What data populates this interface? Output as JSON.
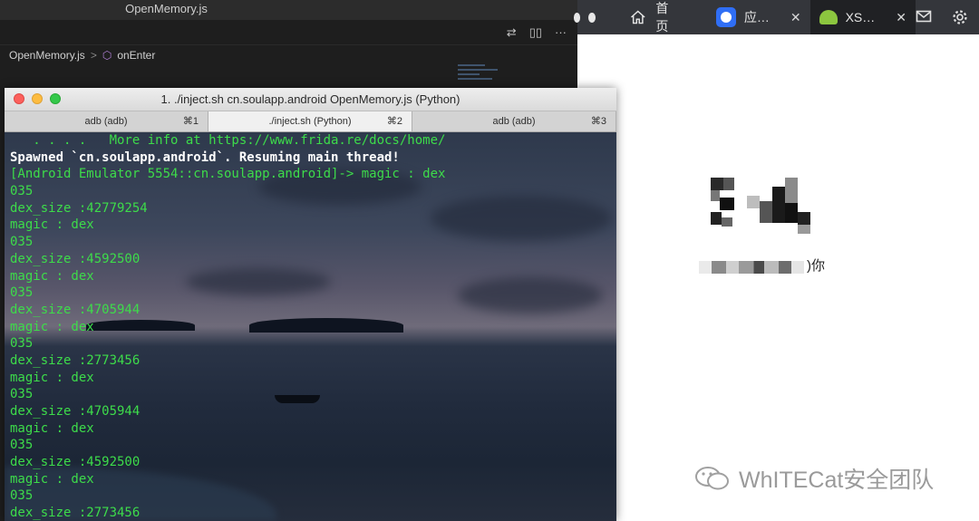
{
  "editor": {
    "window_title": "OpenMemory.js",
    "breadcrumb_file": "OpenMemory.js",
    "breadcrumb_sep": ">",
    "breadcrumb_symbol": "onEnter",
    "action_icons": [
      "source-control-icon",
      "split-editor-icon",
      "more-icon"
    ]
  },
  "browser": {
    "tabs": [
      {
        "label": "首页",
        "icon": "home-icon"
      },
      {
        "label": "应…",
        "icon": "app-icon",
        "close": "✕"
      },
      {
        "label": "XS…",
        "icon": "android-icon",
        "close": "✕",
        "active": true
      }
    ],
    "right_icons": [
      "mail-icon",
      "gear-icon"
    ]
  },
  "content": {
    "ni_text": ")你",
    "watermark": "WhITECat安全团队"
  },
  "terminal": {
    "title": "1. ./inject.sh cn.soulapp.android OpenMemory.js (Python)",
    "tabs": [
      {
        "label": "adb (adb)",
        "shortcut": "⌘1"
      },
      {
        "label": "./inject.sh (Python)",
        "shortcut": "⌘2",
        "active": true
      },
      {
        "label": "adb (adb)",
        "shortcut": "⌘3"
      }
    ],
    "lines": [
      {
        "text": "   . . . .   More info at https://www.frida.re/docs/home/",
        "style": "green"
      },
      {
        "text": "Spawned `cn.soulapp.android`. Resuming main thread!",
        "style": "white"
      },
      {
        "text": "[Android Emulator 5554::cn.soulapp.android]-> magic : dex",
        "style": "green"
      },
      {
        "text": "035",
        "style": "green"
      },
      {
        "text": "dex_size :42779254",
        "style": "green"
      },
      {
        "text": "magic : dex",
        "style": "green"
      },
      {
        "text": "035",
        "style": "green"
      },
      {
        "text": "dex_size :4592500",
        "style": "green"
      },
      {
        "text": "magic : dex",
        "style": "green"
      },
      {
        "text": "035",
        "style": "green"
      },
      {
        "text": "dex_size :4705944",
        "style": "green"
      },
      {
        "text": "magic : dex",
        "style": "green"
      },
      {
        "text": "035",
        "style": "green"
      },
      {
        "text": "dex_size :2773456",
        "style": "green"
      },
      {
        "text": "magic : dex",
        "style": "green"
      },
      {
        "text": "035",
        "style": "green"
      },
      {
        "text": "dex_size :4705944",
        "style": "green"
      },
      {
        "text": "magic : dex",
        "style": "green"
      },
      {
        "text": "035",
        "style": "green"
      },
      {
        "text": "dex_size :4592500",
        "style": "green"
      },
      {
        "text": "magic : dex",
        "style": "green"
      },
      {
        "text": "035",
        "style": "green"
      },
      {
        "text": "dex_size :2773456",
        "style": "green"
      }
    ]
  }
}
